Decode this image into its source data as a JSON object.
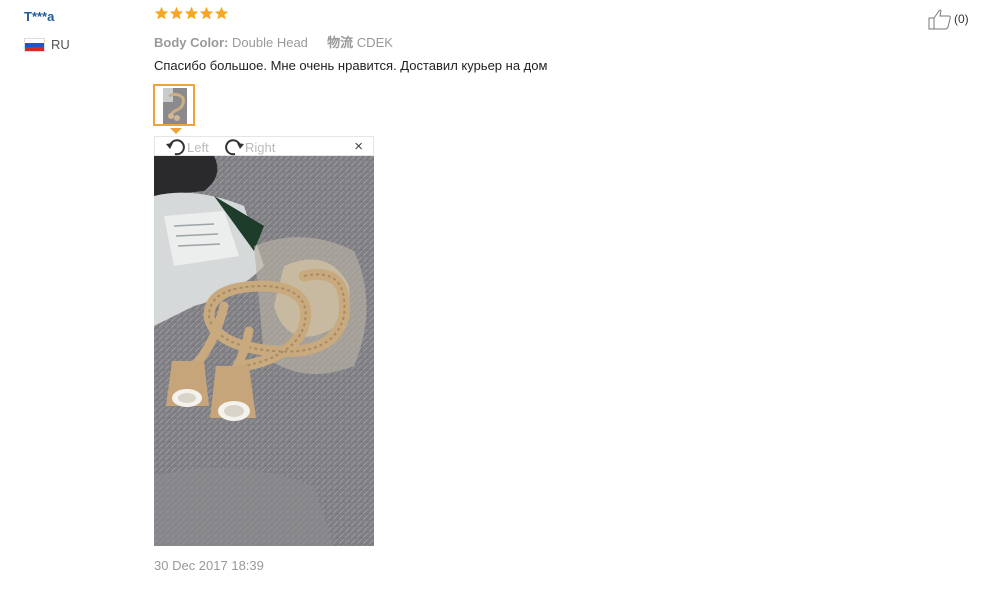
{
  "reviewer": {
    "name": "T***a",
    "country_code": "RU",
    "flag_colors": [
      "#ffffff",
      "#1c57c7",
      "#d52b1e"
    ]
  },
  "review": {
    "rating": 5,
    "star_color": "#f5a623",
    "attributes": [
      {
        "label": "Body Color:",
        "value": "Double Head"
      },
      {
        "label": "物流",
        "value": "CDEK"
      }
    ],
    "text": "Спасибо большое. Мне очень нравится. Доставил курьер на дом",
    "date": "30 Dec 2017 18:39"
  },
  "viewer": {
    "rotate_left_label": "Left",
    "rotate_right_label": "Right",
    "close_label": "×",
    "photo_icon": "product-photo-rope-lamp"
  },
  "helpful": {
    "count_label": "(0)",
    "icon": "thumbs-up-icon"
  },
  "colors": {
    "accent": "#f0a33a",
    "link": "#1f5b9e"
  }
}
